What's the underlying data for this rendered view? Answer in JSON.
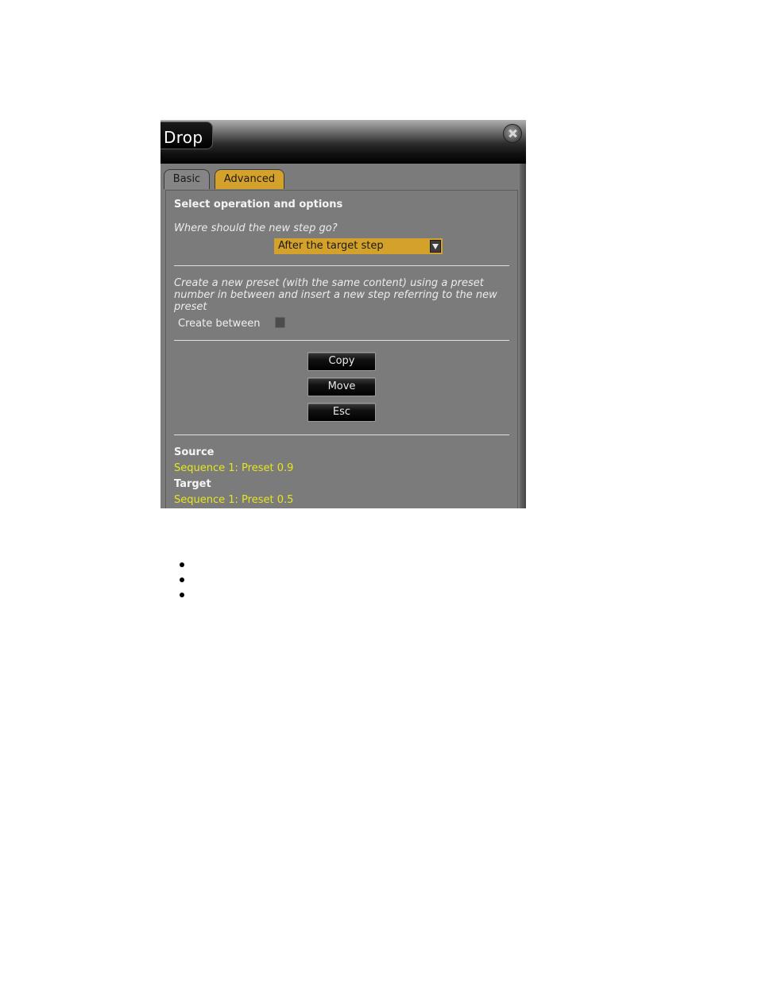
{
  "dialog": {
    "title": "Drop",
    "close_icon": "close-icon",
    "tabs": [
      {
        "label": "Basic",
        "active": false
      },
      {
        "label": "Advanced",
        "active": true
      }
    ],
    "section_heading": "Select operation and options",
    "position_question": "Where should the new step go?",
    "position_dropdown": {
      "selected": "After the target step"
    },
    "create_between_description": "Create a new preset (with the same content) using a preset number in between and insert a new step referring to the new preset",
    "create_between_label": "Create between",
    "create_between_checked": false,
    "buttons": {
      "copy": "Copy",
      "move": "Move",
      "esc": "Esc"
    },
    "source_label": "Source",
    "source_value": "Sequence 1: Preset 0.9",
    "target_label": "Target",
    "target_value": "Sequence 1: Preset 0.5"
  },
  "colors": {
    "accent": "#d4a22a",
    "panel": "#7b7b7b",
    "value_text": "#e6e61e"
  },
  "bullet_list": {
    "item_count": 3
  }
}
